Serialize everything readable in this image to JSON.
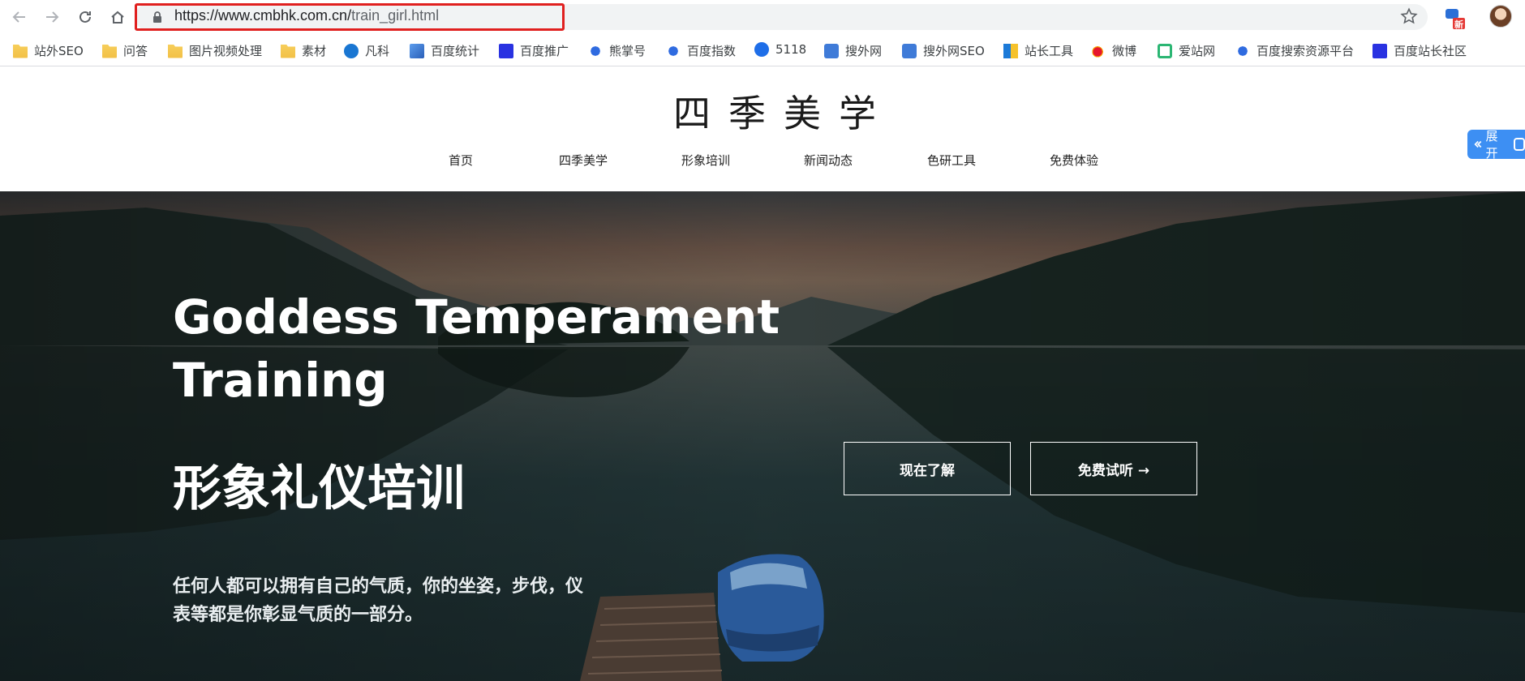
{
  "browser": {
    "url_host": "https://www.cmbhk.com.cn/",
    "url_path": "train_girl.html",
    "ext_badge": "新"
  },
  "bookmarks": [
    {
      "label": "站外SEO",
      "icon": "folder-icon"
    },
    {
      "label": "问答",
      "icon": "folder-icon"
    },
    {
      "label": "图片视频处理",
      "icon": "folder-icon"
    },
    {
      "label": "素材",
      "icon": "folder-icon"
    },
    {
      "label": "凡科",
      "icon": "fanke-icon"
    },
    {
      "label": "百度统计",
      "icon": "chart-icon"
    },
    {
      "label": "百度推广",
      "icon": "baidu-paw-icon"
    },
    {
      "label": "熊掌号",
      "icon": "baidu-paw-icon"
    },
    {
      "label": "百度指数",
      "icon": "baidu-paw-icon"
    },
    {
      "label": "5118",
      "icon": "5118-icon"
    },
    {
      "label": "搜外网",
      "icon": "seowhy-icon"
    },
    {
      "label": "搜外网SEO",
      "icon": "seowhy-icon"
    },
    {
      "label": "站长工具",
      "icon": "chinaz-icon"
    },
    {
      "label": "微博",
      "icon": "weibo-icon"
    },
    {
      "label": "爱站网",
      "icon": "aizhan-icon"
    },
    {
      "label": "百度搜索资源平台",
      "icon": "baidu-paw-icon"
    },
    {
      "label": "百度站长社区",
      "icon": "baidu-paw-icon"
    }
  ],
  "site": {
    "logo": "四季美学",
    "nav": [
      "首页",
      "四季美学",
      "形象培训",
      "新闻动态",
      "色研工具",
      "免费体验"
    ],
    "side_tab": "展开"
  },
  "hero": {
    "title": "Goddess Temperament Training",
    "title_cn": "形象礼仪培训",
    "description": "任何人都可以拥有自己的气质，你的坐姿，步伐，仪表等都是你彰显气质的一部分。",
    "btn_learn": "现在了解",
    "btn_trial": "免费试听 →"
  },
  "colors": {
    "url_highlight": "#e0201f",
    "side_tab": "#3d8ff3",
    "hero_text": "#ffffff"
  }
}
